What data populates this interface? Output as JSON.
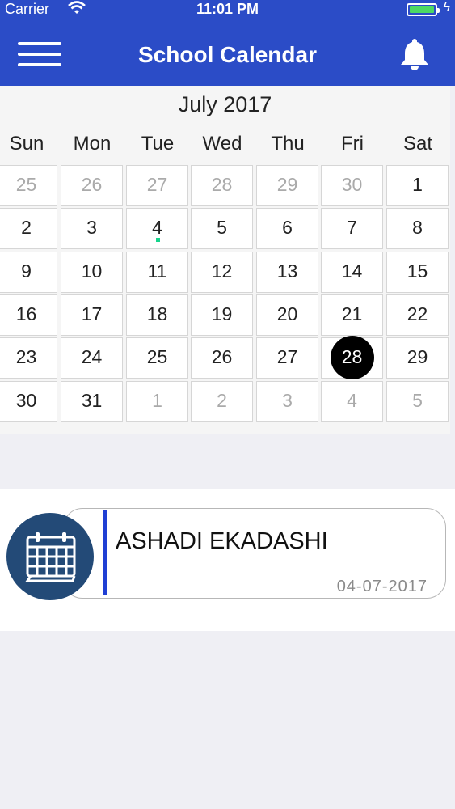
{
  "status_bar": {
    "carrier": "Carrier",
    "time": "11:01 PM"
  },
  "nav": {
    "title": "School Calendar"
  },
  "calendar": {
    "month_label": "July 2017",
    "weekdays": [
      "Sun",
      "Mon",
      "Tue",
      "Wed",
      "Thu",
      "Fri",
      "Sat"
    ],
    "weeks": [
      [
        {
          "d": "25",
          "m": true
        },
        {
          "d": "26",
          "m": true
        },
        {
          "d": "27",
          "m": true
        },
        {
          "d": "28",
          "m": true
        },
        {
          "d": "29",
          "m": true
        },
        {
          "d": "30",
          "m": true
        },
        {
          "d": "1"
        }
      ],
      [
        {
          "d": "2"
        },
        {
          "d": "3"
        },
        {
          "d": "4",
          "event": true
        },
        {
          "d": "5"
        },
        {
          "d": "6"
        },
        {
          "d": "7"
        },
        {
          "d": "8"
        }
      ],
      [
        {
          "d": "9"
        },
        {
          "d": "10"
        },
        {
          "d": "11"
        },
        {
          "d": "12"
        },
        {
          "d": "13"
        },
        {
          "d": "14"
        },
        {
          "d": "15"
        }
      ],
      [
        {
          "d": "16"
        },
        {
          "d": "17"
        },
        {
          "d": "18"
        },
        {
          "d": "19"
        },
        {
          "d": "20"
        },
        {
          "d": "21"
        },
        {
          "d": "22"
        }
      ],
      [
        {
          "d": "23"
        },
        {
          "d": "24"
        },
        {
          "d": "25"
        },
        {
          "d": "26"
        },
        {
          "d": "27"
        },
        {
          "d": "28",
          "selected": true
        },
        {
          "d": "29"
        }
      ],
      [
        {
          "d": "30"
        },
        {
          "d": "31"
        },
        {
          "d": "1",
          "m": true
        },
        {
          "d": "2",
          "m": true
        },
        {
          "d": "3",
          "m": true
        },
        {
          "d": "4",
          "m": true
        },
        {
          "d": "5",
          "m": true
        }
      ]
    ]
  },
  "event": {
    "title": "ASHADI EKADASHI",
    "date": "04-07-2017",
    "icon": "calendar-icon"
  },
  "colors": {
    "nav_bg": "#2b4cc7",
    "event_accent": "#1f3fd4",
    "event_dot": "#16d48c",
    "event_icon_bg": "#234a77"
  }
}
